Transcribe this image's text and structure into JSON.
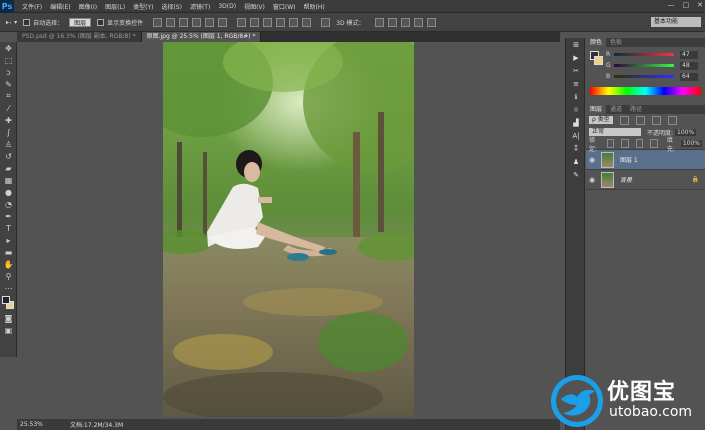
{
  "app": {
    "logo": "Ps"
  },
  "menu": [
    "文件(F)",
    "编辑(E)",
    "图像(I)",
    "图层(L)",
    "类型(Y)",
    "选择(S)",
    "滤镜(T)",
    "3D(D)",
    "视图(V)",
    "窗口(W)",
    "帮助(H)"
  ],
  "window_controls": [
    "—",
    "□",
    "✕"
  ],
  "options_bar": {
    "auto_select_label": "自动选择：",
    "auto_select_value": "图层",
    "show_transform_label": "显示变换控件",
    "mode_3d_label": "3D 模式：",
    "workspace": "基本功能"
  },
  "doc_tabs": [
    {
      "label": "PSD.psd @ 16.3% (图层 副本, RGB/8) *",
      "active": false
    },
    {
      "label": "原图.jpg @ 25.5% (图层 1, RGB/8#) *",
      "active": true
    }
  ],
  "status": {
    "zoom": "25.53%",
    "doc_size": "文档:17.2M/34.3M"
  },
  "color_panel": {
    "tabs": [
      "颜色",
      "色板"
    ],
    "r_label": "R",
    "r_value": "47",
    "g_label": "G",
    "g_value": "48",
    "b_label": "B",
    "b_value": "64",
    "fg_color": "#2f3040"
  },
  "layers_panel": {
    "tabs": [
      "图层",
      "通道",
      "路径"
    ],
    "filter_label": "ρ 类型",
    "blend_mode": "正常",
    "opacity_label": "不透明度:",
    "opacity_value": "100%",
    "lock_label": "锁定:",
    "fill_label": "填充:",
    "fill_value": "100%",
    "layers": [
      {
        "name": "图层 1",
        "selected": true,
        "locked": false
      },
      {
        "name": "背景",
        "selected": false,
        "locked": true
      }
    ]
  },
  "watermark": {
    "chinese": "优图宝",
    "url": "utobao.com"
  }
}
